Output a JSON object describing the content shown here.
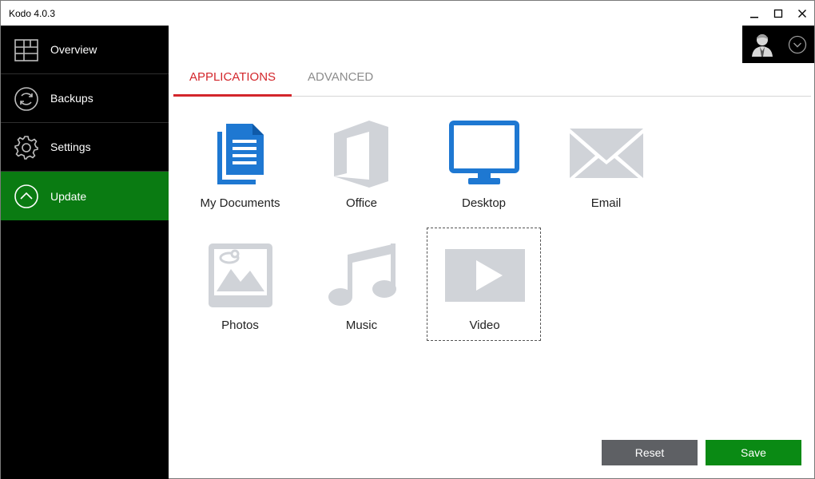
{
  "window": {
    "title": "Kodo 4.0.3"
  },
  "sidebar": {
    "items": [
      {
        "label": "Overview",
        "icon": "overview-icon",
        "active": false
      },
      {
        "label": "Backups",
        "icon": "backups-icon",
        "active": false
      },
      {
        "label": "Settings",
        "icon": "settings-icon",
        "active": false
      },
      {
        "label": "Update",
        "icon": "update-icon",
        "active": true
      }
    ]
  },
  "tabs": [
    {
      "label": "APPLICATIONS",
      "active": true
    },
    {
      "label": "ADVANCED",
      "active": false
    }
  ],
  "apps": [
    {
      "label": "My Documents",
      "icon": "documents-icon",
      "enabled": true
    },
    {
      "label": "Office",
      "icon": "office-icon",
      "enabled": false
    },
    {
      "label": "Desktop",
      "icon": "desktop-icon",
      "enabled": true
    },
    {
      "label": "Email",
      "icon": "email-icon",
      "enabled": false
    },
    {
      "label": "Photos",
      "icon": "photos-icon",
      "enabled": false
    },
    {
      "label": "Music",
      "icon": "music-icon",
      "enabled": false
    },
    {
      "label": "Video",
      "icon": "video-icon",
      "enabled": false,
      "focused": true
    }
  ],
  "buttons": {
    "reset": "Reset",
    "save": "Save"
  },
  "colors": {
    "accent_red": "#d3262b",
    "active_green": "#0a7b12",
    "save_green": "#0a8a14",
    "enabled_blue": "#1e78d2",
    "disabled_gray": "#d0d3d8"
  }
}
